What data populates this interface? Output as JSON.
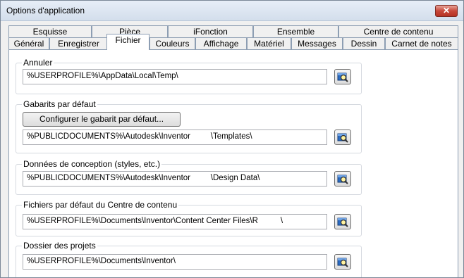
{
  "window": {
    "title": "Options d'application",
    "close_label": "✕"
  },
  "tabs_row1": [
    "Esquisse",
    "Pièce",
    "iFonction",
    "Ensemble",
    "Centre de contenu"
  ],
  "tabs_row2": [
    "Général",
    "Enregistrer",
    "Fichier",
    "Couleurs",
    "Affichage",
    "Matériel",
    "Messages",
    "Dessin",
    "Carnet de notes"
  ],
  "active_tab": "Fichier",
  "groups": {
    "annuler": {
      "label": "Annuler",
      "path": "%USERPROFILE%\\AppData\\Local\\Temp\\"
    },
    "gabarits": {
      "label": "Gabarits par défaut",
      "button": "Configurer le gabarit par défaut...",
      "path": "%PUBLICDOCUMENTS%\\Autodesk\\Inventor         \\Templates\\"
    },
    "donnees": {
      "label": "Données de conception (styles, etc.)",
      "path": "%PUBLICDOCUMENTS%\\Autodesk\\Inventor         \\Design Data\\"
    },
    "centre": {
      "label": "Fichiers par défaut du Centre de contenu",
      "path": "%USERPROFILE%\\Documents\\Inventor\\Content Center Files\\R          \\"
    },
    "projets": {
      "label": "Dossier des projets",
      "path": "%USERPROFILE%\\Documents\\Inventor\\"
    }
  }
}
